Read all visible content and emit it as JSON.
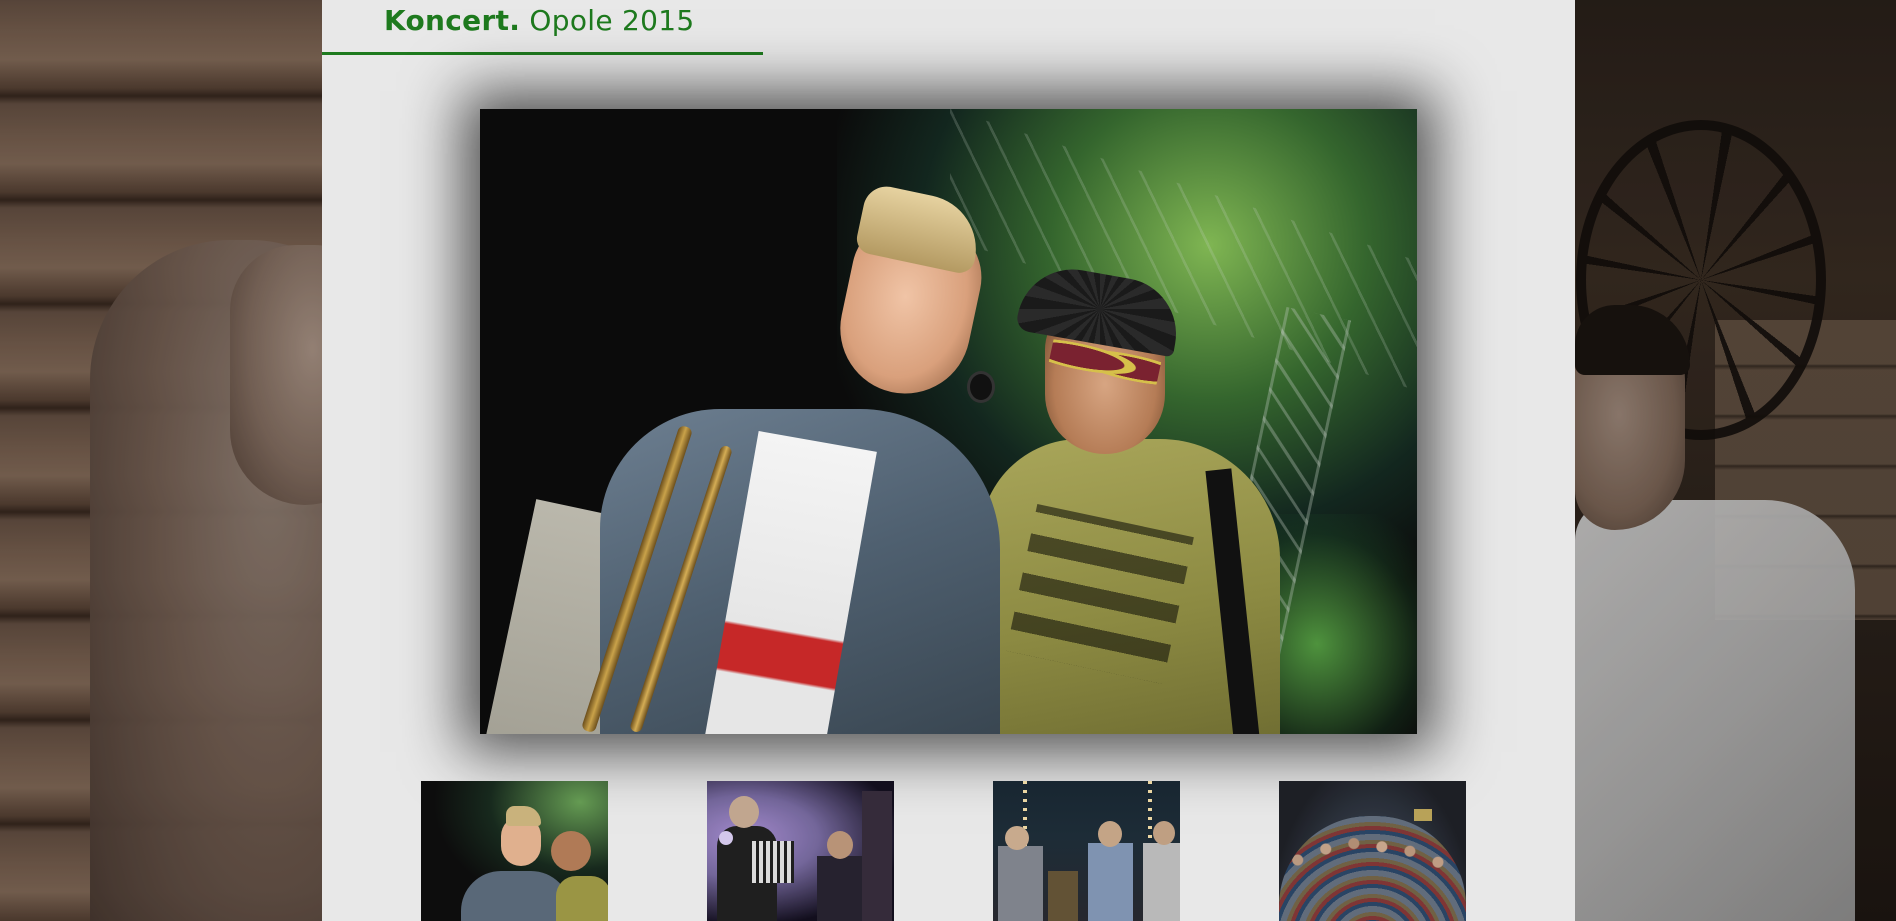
{
  "page": {
    "title_bold": "Koncert.",
    "title_light": "Opole 2015"
  },
  "colors": {
    "accent_green": "#1e7a1e",
    "panel_bg": "#e8e8e8"
  },
  "gallery": {
    "main_image": "concert-photo-two-performers",
    "thumbnails": [
      {
        "image": "thumb-performers-on-stage",
        "active": true
      },
      {
        "image": "thumb-accordion-player",
        "active": false
      },
      {
        "image": "thumb-brass-section",
        "active": false
      },
      {
        "image": "thumb-crowd",
        "active": false
      }
    ]
  }
}
